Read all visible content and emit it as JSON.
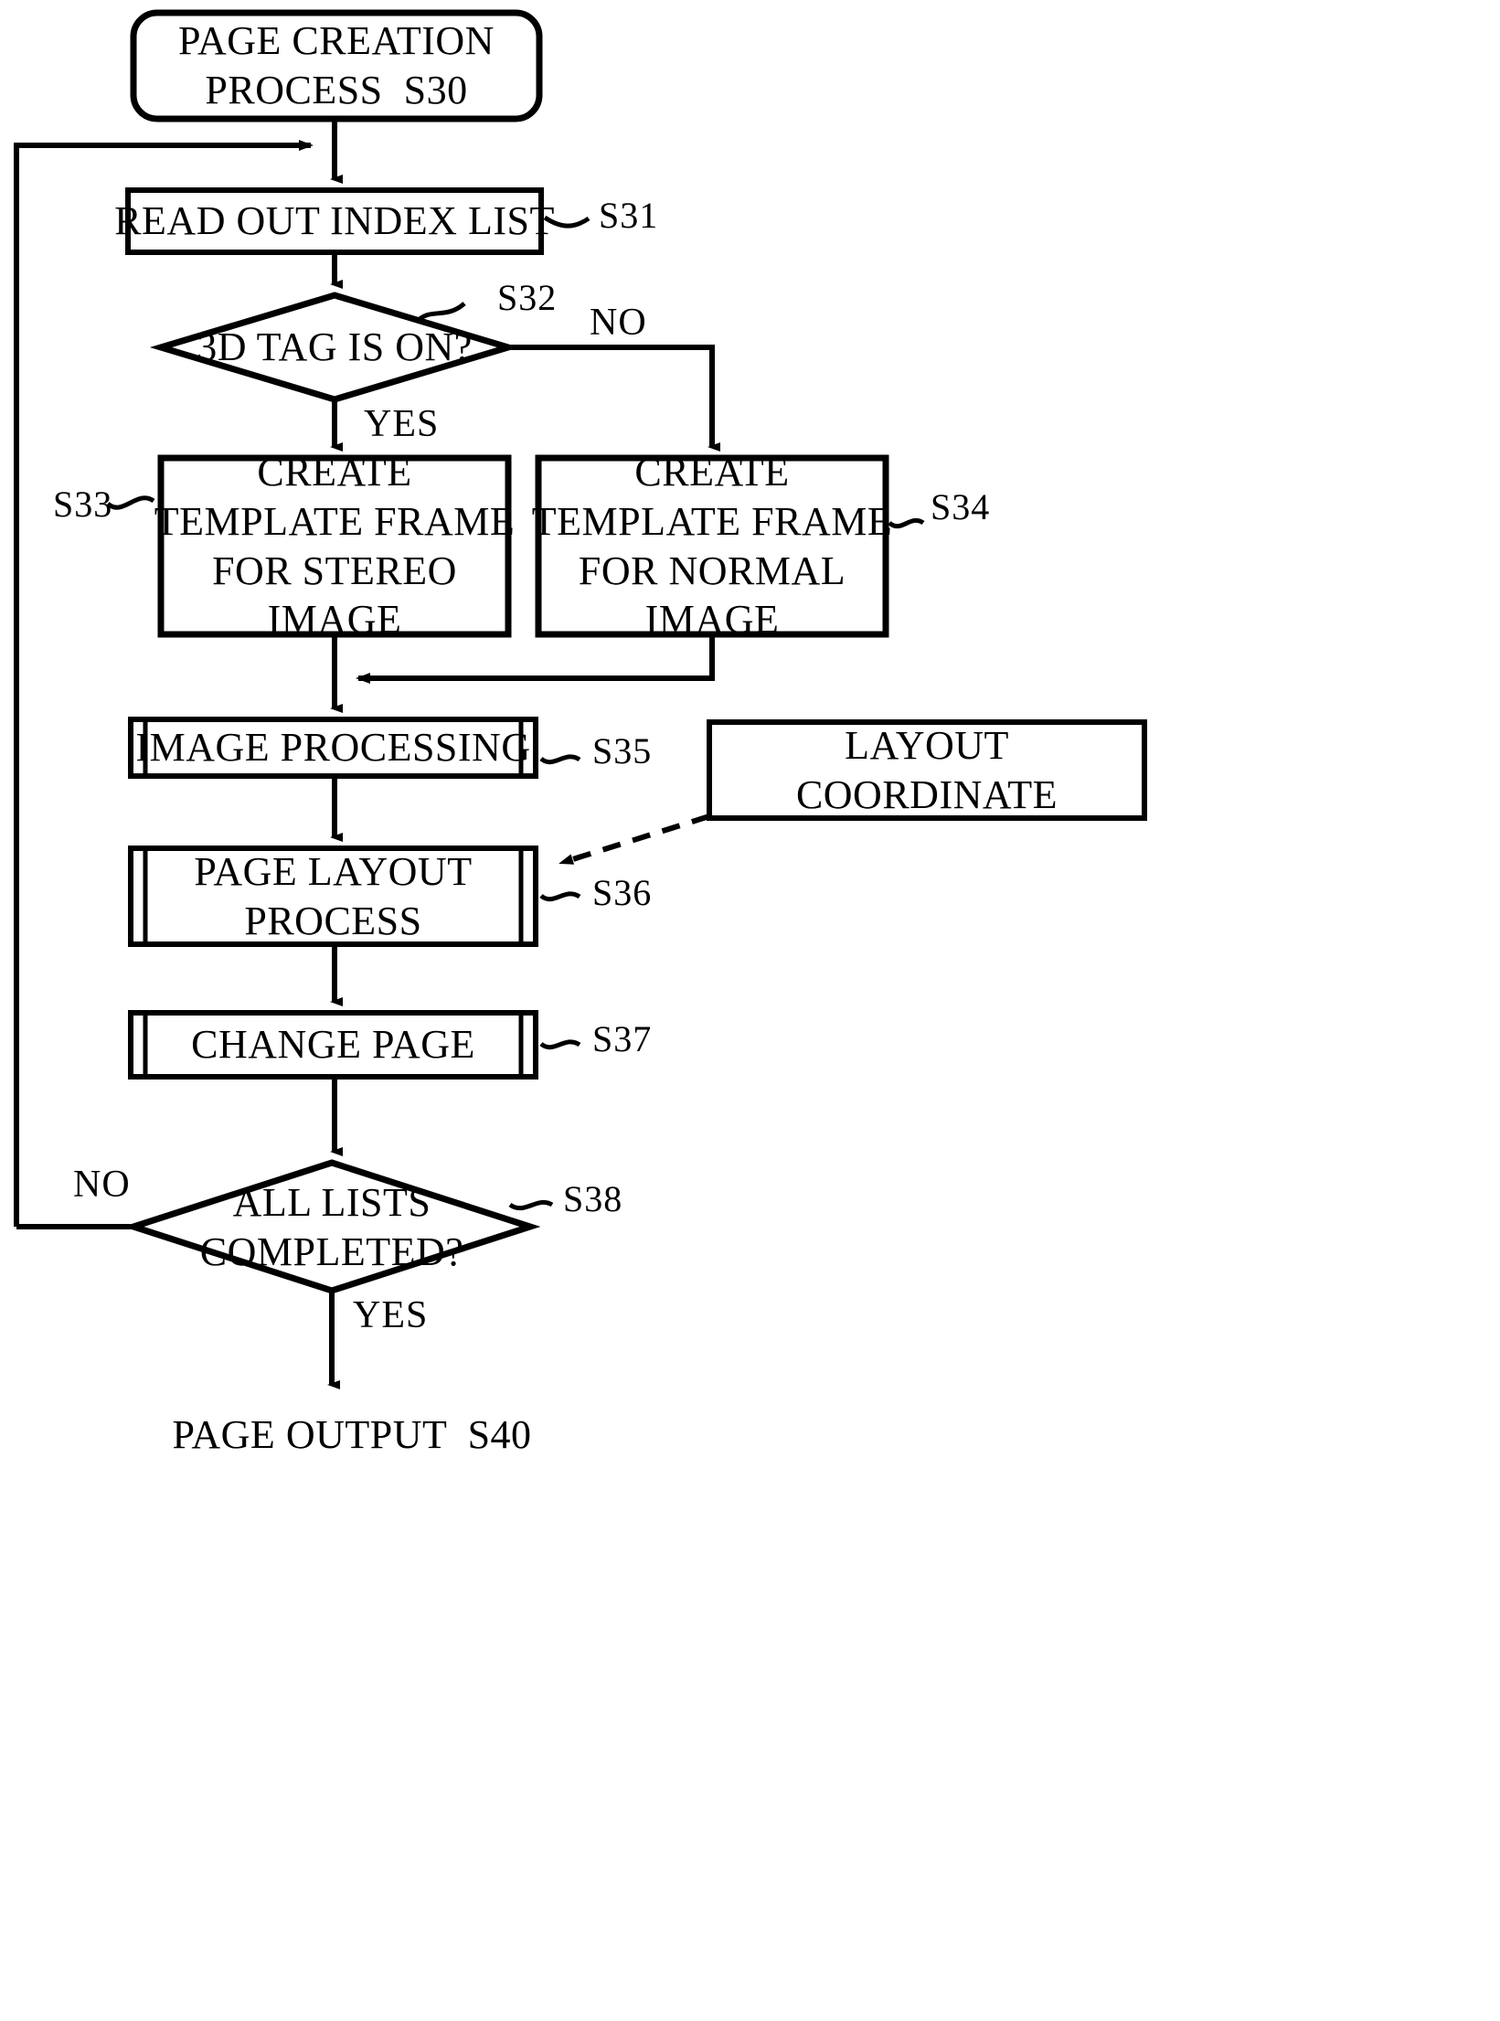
{
  "diagram": {
    "type": "flowchart",
    "title": "Page Creation Process Flowchart",
    "nodes": {
      "start": {
        "shape": "rounded-rectangle",
        "lines": [
          "PAGE CREATION",
          "PROCESS  S30"
        ],
        "ref": "S30"
      },
      "read_index": {
        "shape": "rectangle",
        "lines": [
          "READ OUT INDEX LIST"
        ],
        "ref": "S31"
      },
      "tag_decision": {
        "shape": "diamond",
        "lines": [
          "3D TAG IS ON?"
        ],
        "ref": "S32"
      },
      "stereo_frame": {
        "shape": "rectangle",
        "lines": [
          "CREATE",
          "TEMPLATE FRAME",
          "FOR STEREO",
          "IMAGE"
        ],
        "ref": "S33"
      },
      "normal_frame": {
        "shape": "rectangle",
        "lines": [
          "CREATE",
          "TEMPLATE FRAME",
          "FOR NORMAL",
          "IMAGE"
        ],
        "ref": "S34"
      },
      "image_processing": {
        "shape": "predefined-process",
        "lines": [
          "IMAGE PROCESSING"
        ],
        "ref": "S35"
      },
      "page_layout": {
        "shape": "predefined-process",
        "lines": [
          "PAGE LAYOUT",
          "PROCESS"
        ],
        "ref": "S36"
      },
      "change_page": {
        "shape": "predefined-process",
        "lines": [
          "CHANGE PAGE"
        ],
        "ref": "S37"
      },
      "all_lists_decision": {
        "shape": "diamond",
        "lines": [
          "ALL LISTS",
          "COMPLETED?"
        ],
        "ref": "S38"
      },
      "layout_coordinate": {
        "shape": "rectangle",
        "lines": [
          "LAYOUT",
          "COORDINATE"
        ],
        "ref": ""
      },
      "page_output": {
        "shape": "text",
        "lines": [
          "PAGE OUTPUT  S40"
        ],
        "ref": "S40"
      }
    },
    "edge_labels": {
      "tag_no": "NO",
      "tag_yes": "YES",
      "lists_no": "NO",
      "lists_yes": "YES"
    },
    "colors": {
      "stroke": "#000000",
      "fill": "#ffffff",
      "text": "#000000"
    }
  }
}
